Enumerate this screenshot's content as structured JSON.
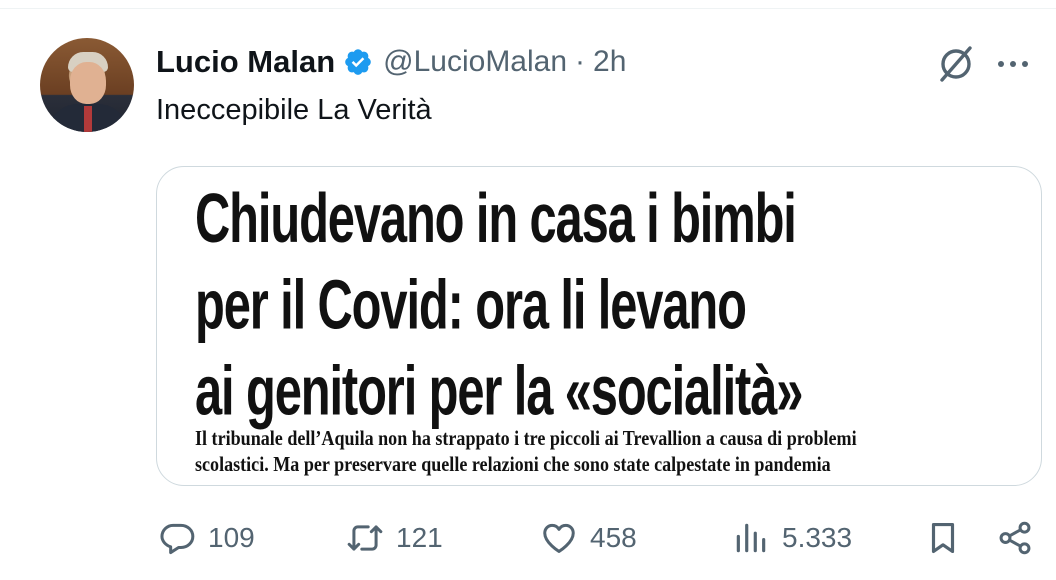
{
  "tweet": {
    "author_name": "Lucio Malan",
    "handle": "@LucioMalan",
    "separator": "·",
    "time": "2h",
    "text": "Ineccepibile La Verità",
    "verified_color": "#1d9bf0"
  },
  "media": {
    "headline_lines": [
      "Chiudevano in casa i bimbi",
      "per il Covid: ora li levano",
      "ai genitori per la «socialità»"
    ],
    "subhead_lines": [
      "Il tribunale dell’Aquila non ha strappato i tre piccoli ai Trevallion a causa di problemi",
      "scolastici. Ma per preservare quelle relazioni che sono state calpestate in pandemia"
    ]
  },
  "actions": {
    "replies": "109",
    "reposts": "121",
    "likes": "458",
    "views": "5.333"
  },
  "icons": {
    "reply": "speech-bubble-icon",
    "repost": "repost-arrows-icon",
    "like": "heart-icon",
    "views": "bar-chart-icon",
    "bookmark": "bookmark-icon",
    "share": "share-icon",
    "grok": "grok-icon",
    "more": "more-dots-icon"
  },
  "colors": {
    "text_primary": "#0f1419",
    "text_secondary": "#536471",
    "border": "#cfd9de"
  }
}
